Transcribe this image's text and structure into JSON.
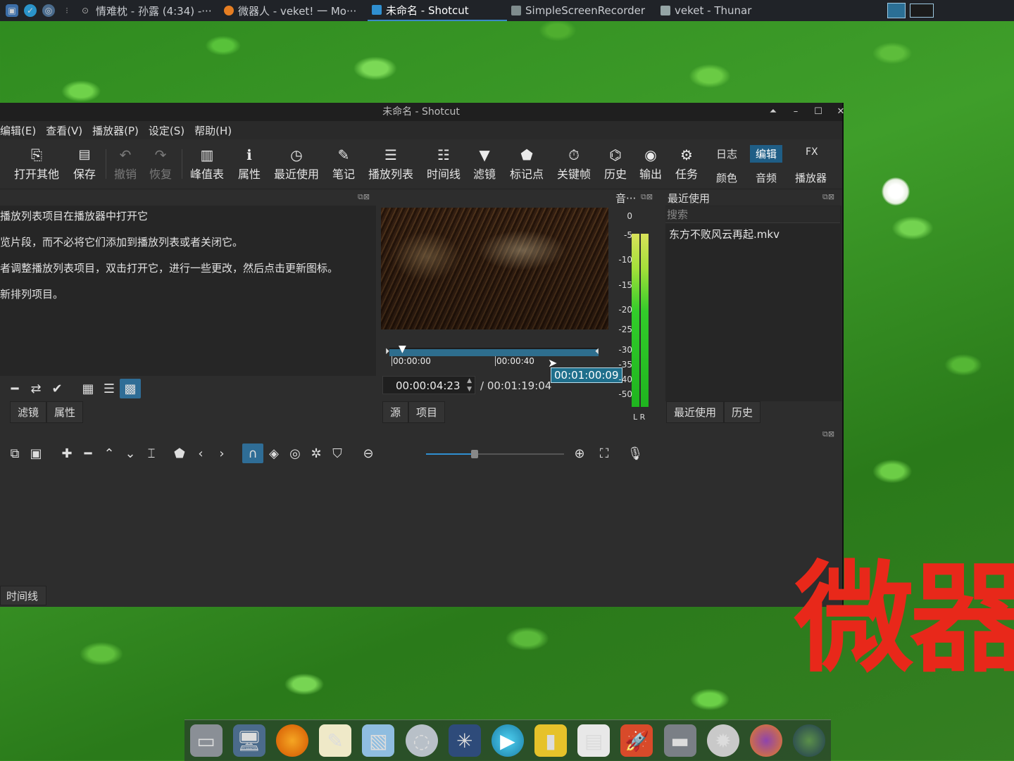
{
  "top_panel": {
    "tasks": [
      {
        "label": "情难枕 - 孙露 (4:34) -···",
        "color": "#c0392b"
      },
      {
        "label": "微器人 - veket! 一 Mo···",
        "color": "#e67e22"
      },
      {
        "label": "未命名 - Shotcut",
        "color": "#2f8fd0"
      },
      {
        "label": "SimpleScreenRecorder",
        "color": "#7f8c8d"
      },
      {
        "label": "veket - Thunar",
        "color": "#95a5a6"
      }
    ]
  },
  "window": {
    "title": "未命名 - Shotcut",
    "menu": [
      "编辑(E)",
      "查看(V)",
      "播放器(P)",
      "设定(S)",
      "帮助(H)"
    ],
    "toolbar": [
      {
        "label": "打开其他",
        "icon": "open-other-icon",
        "glyph": "⎘"
      },
      {
        "label": "保存",
        "icon": "save-icon",
        "glyph": "💾"
      },
      {
        "label": "撤销",
        "icon": "undo-icon",
        "glyph": "↶"
      },
      {
        "label": "恢复",
        "icon": "redo-icon",
        "glyph": "↷"
      },
      {
        "label": "峰值表",
        "icon": "peak-meter-icon",
        "glyph": "▥"
      },
      {
        "label": "属性",
        "icon": "properties-icon",
        "glyph": "ℹ"
      },
      {
        "label": "最近使用",
        "icon": "recent-icon",
        "glyph": "◷"
      },
      {
        "label": "笔记",
        "icon": "notes-icon",
        "glyph": "✎"
      },
      {
        "label": "播放列表",
        "icon": "playlist-icon",
        "glyph": "☰"
      },
      {
        "label": "时间线",
        "icon": "timeline-icon",
        "glyph": "☷"
      },
      {
        "label": "滤镜",
        "icon": "filter-icon",
        "glyph": "▼"
      },
      {
        "label": "标记点",
        "icon": "marker-icon",
        "glyph": "⬟"
      },
      {
        "label": "关键帧",
        "icon": "keyframe-icon",
        "glyph": "⏱"
      },
      {
        "label": "历史",
        "icon": "history-icon",
        "glyph": "⌬"
      },
      {
        "label": "输出",
        "icon": "export-icon",
        "glyph": "◉"
      },
      {
        "label": "任务",
        "icon": "jobs-icon",
        "glyph": "⚙"
      }
    ],
    "layouts": {
      "log": "日志",
      "edit": "编辑",
      "fx": "FX",
      "color": "颜色",
      "audio": "音频",
      "player": "播放器"
    },
    "playlist_help": [
      "播放列表项目在播放器中打开它",
      "览片段，而不必将它们添加到播放列表或者关闭它。",
      "者调整播放列表项目，双击打开它，进行一些更改，然后点击更新图标。",
      "新排列项目。"
    ],
    "left_tabs": [
      "滤镜",
      "属性"
    ],
    "player": {
      "time_left": "00:00:00",
      "time_mid": "00:00:40",
      "tooltip": "00:01:00:09",
      "position": "00:00:04:23",
      "duration": "/ 00:01:19:04",
      "tabs": [
        "源",
        "项目"
      ]
    },
    "audio_meter": {
      "title": "音···",
      "scale": [
        "0",
        "-5",
        "-10",
        "-15",
        "-20",
        "-25",
        "-30",
        "-35",
        "-40",
        "-50"
      ],
      "channels": "L R"
    },
    "recent": {
      "title": "最近使用",
      "search_placeholder": "搜索",
      "items": [
        "东方不败风云再起.mkv"
      ],
      "tabs": [
        "最近使用",
        "历史"
      ]
    },
    "timeline_tab": "时间线"
  },
  "desktop": {
    "overlay_text": "微器"
  }
}
